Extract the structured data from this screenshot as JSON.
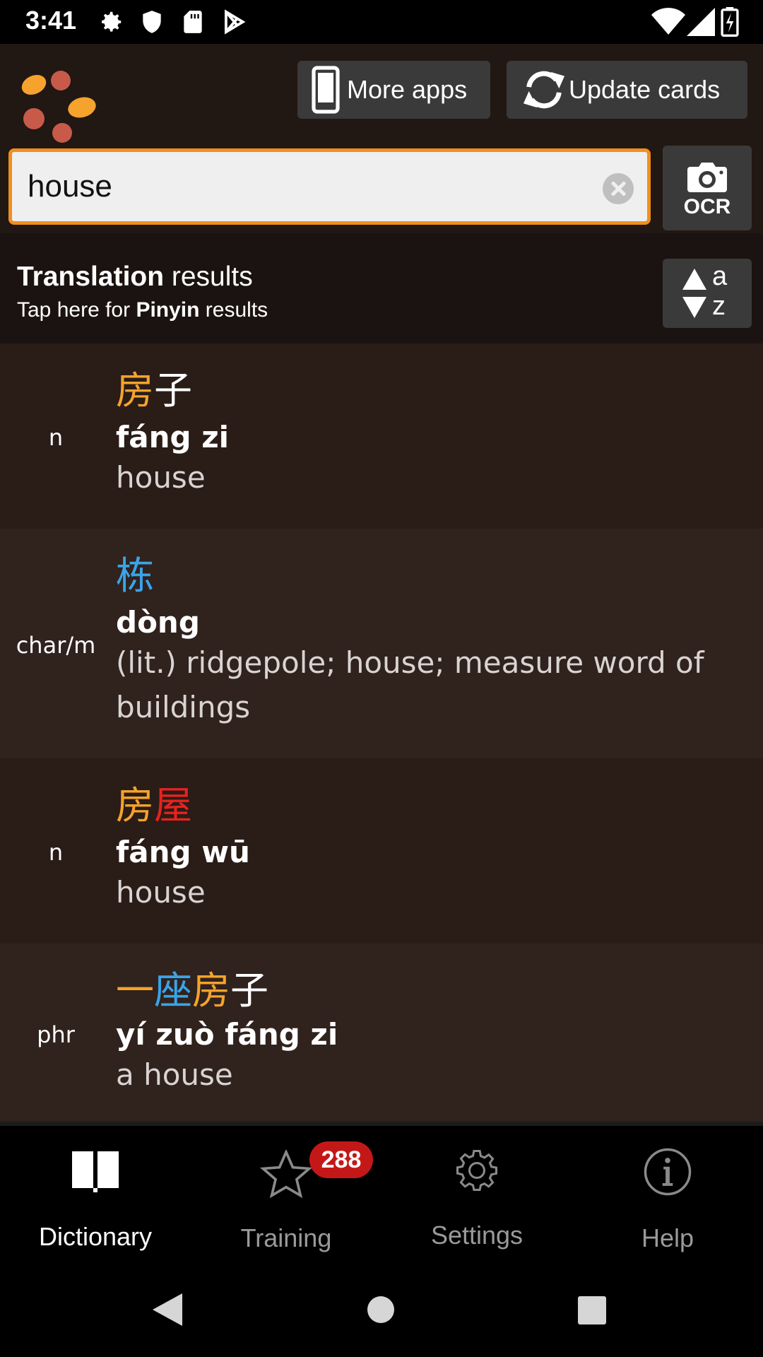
{
  "status_bar": {
    "time": "3:41",
    "left_icons": [
      "settings-icon",
      "shield-icon",
      "sd-card-icon",
      "play-store-icon"
    ],
    "right_icons": [
      "wifi-icon",
      "signal-icon",
      "battery-icon"
    ]
  },
  "header": {
    "more_apps_label": "More apps",
    "update_cards_label": "Update cards",
    "logo": "app-logo-dots"
  },
  "search": {
    "value": "house",
    "ocr_label": "OCR"
  },
  "results_header": {
    "title_bold": "Translation",
    "title_rest": " results",
    "subtitle_pre": "Tap here for ",
    "subtitle_bold": "Pinyin",
    "subtitle_post": " results",
    "sort_top": "a",
    "sort_bottom": "z"
  },
  "entries": [
    {
      "pos": "n",
      "chars": [
        {
          "c": "房",
          "color": "#f5a32c"
        },
        {
          "c": "子",
          "color": "#ffffff"
        }
      ],
      "pinyin": "fáng zi",
      "meaning": "house"
    },
    {
      "pos": "char/m",
      "chars": [
        {
          "c": "栋",
          "color": "#3aa4e8"
        }
      ],
      "pinyin": "dòng",
      "meaning": "(lit.) ridgepole; house; measure word of buildings"
    },
    {
      "pos": "n",
      "chars": [
        {
          "c": "房",
          "color": "#f5a32c"
        },
        {
          "c": "屋",
          "color": "#e8221f"
        }
      ],
      "pinyin": "fáng wū",
      "meaning": "house"
    },
    {
      "pos": "phr",
      "chars": [
        {
          "c": "一",
          "color": "#f5a32c"
        },
        {
          "c": "座",
          "color": "#3aa4e8"
        },
        {
          "c": "房",
          "color": "#f5a32c"
        },
        {
          "c": "子",
          "color": "#ffffff"
        }
      ],
      "pinyin": "yí zuò fáng zi",
      "meaning": "a house"
    }
  ],
  "bottom_nav": {
    "items": [
      {
        "label": "Dictionary",
        "icon": "book-icon",
        "active": true
      },
      {
        "label": "Training",
        "icon": "star-icon",
        "active": false
      },
      {
        "label": "Settings",
        "icon": "gear-icon",
        "active": false
      },
      {
        "label": "Help",
        "icon": "info-icon",
        "active": false
      }
    ],
    "training_badge": "288"
  },
  "colors": {
    "accent_orange": "#f0901e",
    "tone_orange": "#f5a32c",
    "tone_blue": "#3aa4e8",
    "tone_red": "#e8221f",
    "badge_red": "#c41818"
  }
}
